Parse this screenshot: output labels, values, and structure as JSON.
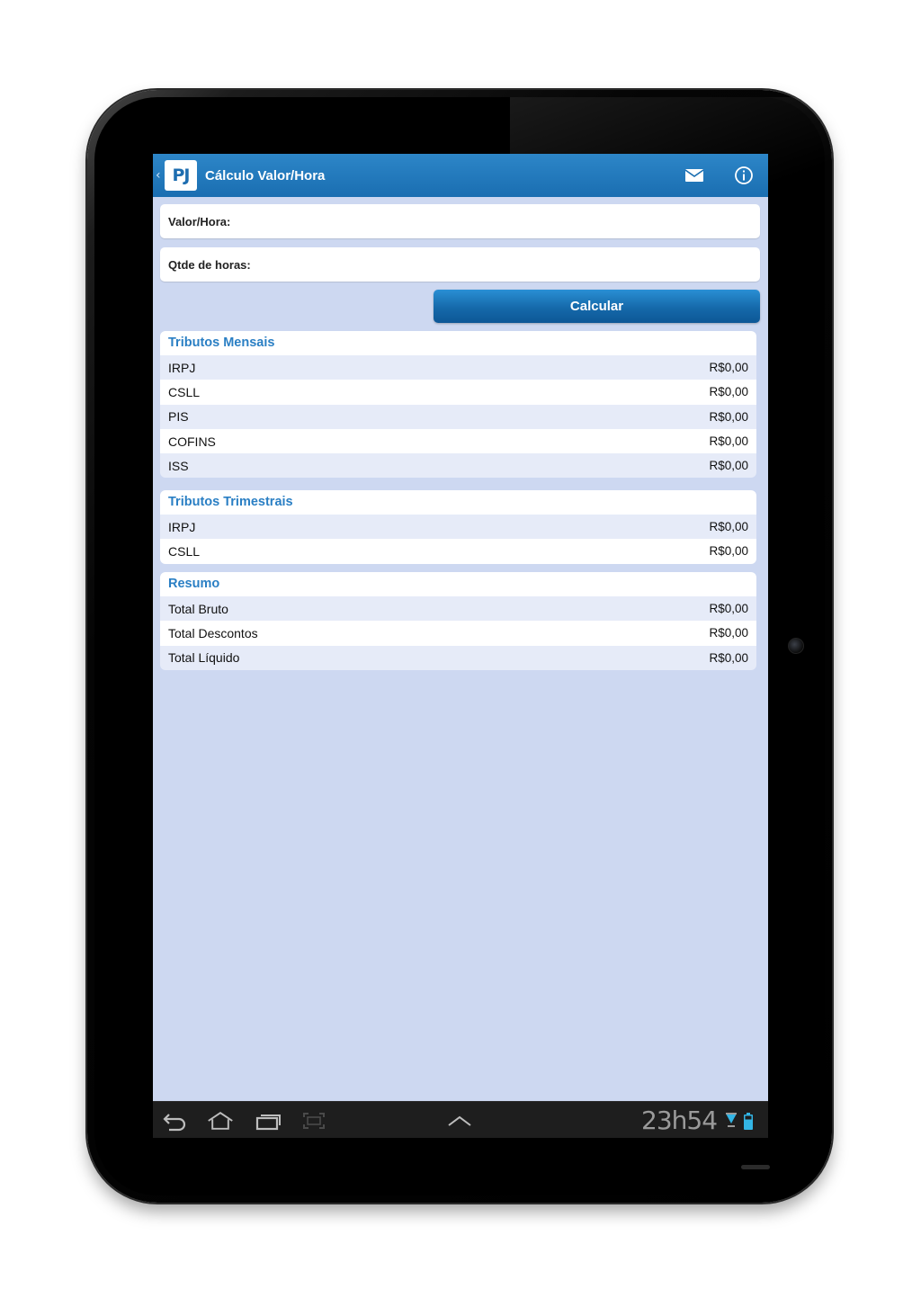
{
  "app": {
    "logo_text": "PJ",
    "title": "Cálculo Valor/Hora",
    "back_glyph": "‹"
  },
  "actionbar_icons": [
    "mail-icon",
    "info-icon"
  ],
  "form": {
    "valor_hora_label": "Valor/Hora:",
    "valor_hora_value": "",
    "qtde_horas_label": "Qtde de horas:",
    "qtde_horas_value": "",
    "calcular_label": "Calcular"
  },
  "tributos_mensais": {
    "title": "Tributos Mensais",
    "rows": [
      {
        "label": "IRPJ",
        "value": "R$0,00"
      },
      {
        "label": "CSLL",
        "value": "R$0,00"
      },
      {
        "label": "PIS",
        "value": "R$0,00"
      },
      {
        "label": "COFINS",
        "value": "R$0,00"
      },
      {
        "label": "ISS",
        "value": "R$0,00"
      }
    ]
  },
  "tributos_trimestrais": {
    "title": "Tributos Trimestrais",
    "rows": [
      {
        "label": "IRPJ",
        "value": "R$0,00"
      },
      {
        "label": "CSLL",
        "value": "R$0,00"
      }
    ]
  },
  "resumo": {
    "title": "Resumo",
    "rows": [
      {
        "label": "Total Bruto",
        "value": "R$0,00"
      },
      {
        "label": "Total Descontos",
        "value": "R$0,00"
      },
      {
        "label": "Total Líquido",
        "value": "R$0,00"
      }
    ]
  },
  "systembar": {
    "clock": "23h54",
    "nav_icons": [
      "back-icon",
      "home-icon",
      "recent-apps-icon",
      "screenshot-icon",
      "chevron-up-icon"
    ],
    "status_icons": [
      "wifi-icon",
      "battery-icon"
    ]
  },
  "colors": {
    "actionbar": "#1a6eb1",
    "screen_bg": "#cdd8f1",
    "section_title": "#2a7fc4",
    "button": "#1569aa"
  }
}
